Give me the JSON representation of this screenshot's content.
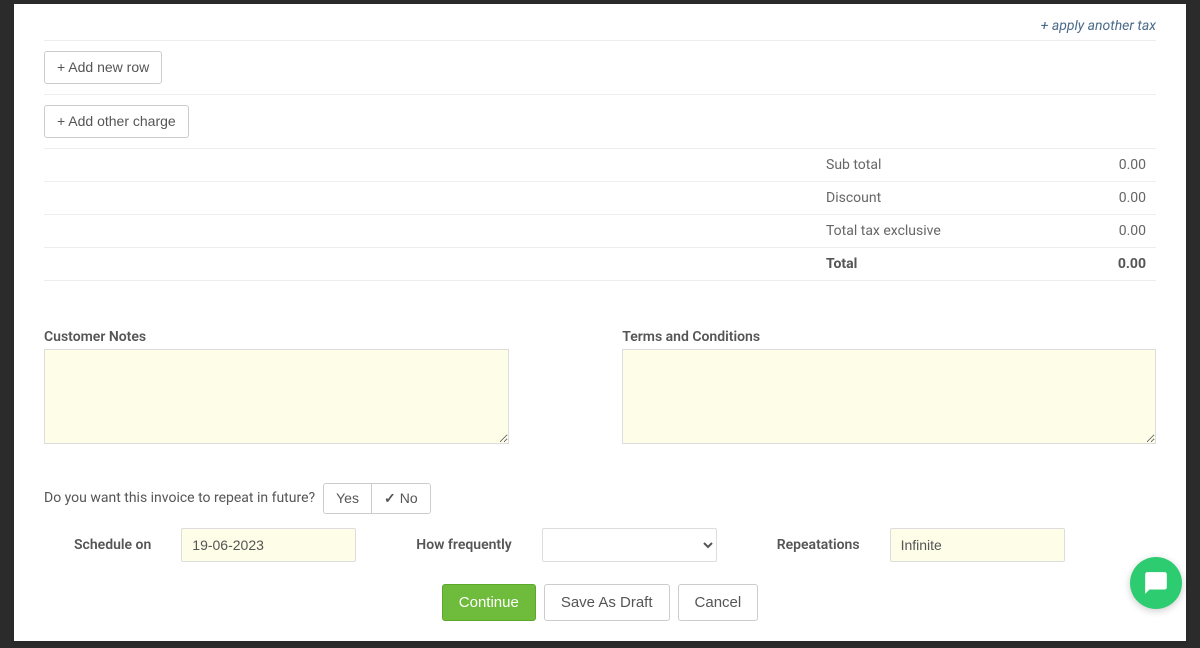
{
  "links": {
    "apply_another_tax": "+ apply another tax"
  },
  "buttons": {
    "add_new_row": "+ Add new row",
    "add_other_charge": "+ Add other charge",
    "continue": "Continue",
    "save_as_draft": "Save As Draft",
    "cancel": "Cancel"
  },
  "totals": {
    "subtotal_label": "Sub total",
    "subtotal_value": "0.00",
    "discount_label": "Discount",
    "discount_value": "0.00",
    "tax_exclusive_label": "Total tax exclusive",
    "tax_exclusive_value": "0.00",
    "total_label": "Total",
    "total_value": "0.00"
  },
  "notes": {
    "customer_label": "Customer Notes",
    "customer_value": "",
    "terms_label": "Terms and Conditions",
    "terms_value": ""
  },
  "repeat": {
    "question": "Do you want this invoice to repeat in future?",
    "yes": "Yes",
    "no": "No",
    "selected": "No",
    "schedule_label": "Schedule on",
    "schedule_value": "19-06-2023",
    "frequency_label": "How frequently",
    "frequency_value": "",
    "repetitions_label": "Repeatations",
    "repetitions_value": "Infinite"
  }
}
